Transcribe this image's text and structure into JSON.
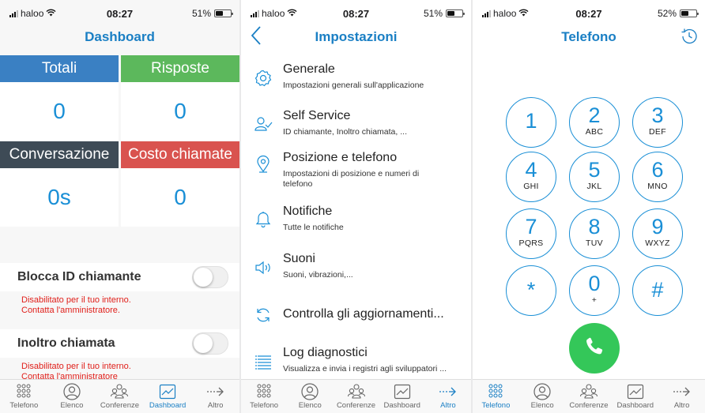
{
  "status": [
    {
      "carrier": "haloo",
      "time": "08:27",
      "battery": "51%",
      "battery_level": 0.51
    },
    {
      "carrier": "haloo",
      "time": "08:27",
      "battery": "51%",
      "battery_level": 0.51
    },
    {
      "carrier": "haloo",
      "time": "08:27",
      "battery": "52%",
      "battery_level": 0.52
    }
  ],
  "dashboard": {
    "title": "Dashboard",
    "tiles": [
      {
        "label": "Totali",
        "value": "0",
        "color": "#3a80c3"
      },
      {
        "label": "Risposte",
        "value": "0",
        "color": "#5cb85c"
      },
      {
        "label": "Conversazione",
        "value": "0s",
        "color": "#3e4b56"
      },
      {
        "label": "Costo chiamate",
        "value": "0",
        "color": "#d9534f"
      }
    ],
    "settings": [
      {
        "label": "Blocca ID chiamante",
        "enabled": false,
        "note_line1": "Disabilitato per il tuo interno.",
        "note_line2": "Contatta l'amministratore."
      },
      {
        "label": "Inoltro chiamata",
        "enabled": false,
        "note_line1": "Disabilitato per il tuo interno.",
        "note_line2": "Contatta l'amministratore"
      }
    ]
  },
  "impostazioni": {
    "title": "Impostazioni",
    "items": [
      {
        "title": "Generale",
        "subtitle": "Impostazioni generali sull'applicazione",
        "icon": "gear-icon"
      },
      {
        "title": "Self Service",
        "subtitle": "ID chiamante, Inoltro chiamata, ...",
        "icon": "user-check-icon"
      },
      {
        "title": "Posizione e telefono",
        "subtitle": "Impostazioni di posizione e numeri di telefono",
        "icon": "location-pin-icon"
      },
      {
        "title": "Notifiche",
        "subtitle": "Tutte le notifiche",
        "icon": "bell-icon"
      },
      {
        "title": "Suoni",
        "subtitle": "Suoni, vibrazioni,...",
        "icon": "speaker-icon"
      },
      {
        "title": "Controlla gli aggiornamenti...",
        "subtitle": "",
        "icon": "refresh-icon"
      },
      {
        "title": "Log diagnostici",
        "subtitle": "Visualizza e invia i registri agli sviluppatori ...",
        "icon": "list-icon"
      }
    ]
  },
  "telefono": {
    "title": "Telefono",
    "keys": [
      {
        "digit": "1",
        "letters": ""
      },
      {
        "digit": "2",
        "letters": "ABC"
      },
      {
        "digit": "3",
        "letters": "DEF"
      },
      {
        "digit": "4",
        "letters": "GHI"
      },
      {
        "digit": "5",
        "letters": "JKL"
      },
      {
        "digit": "6",
        "letters": "MNO"
      },
      {
        "digit": "7",
        "letters": "PQRS"
      },
      {
        "digit": "8",
        "letters": "TUV"
      },
      {
        "digit": "9",
        "letters": "WXYZ"
      },
      {
        "digit": "*",
        "letters": ""
      },
      {
        "digit": "0",
        "letters": "+"
      },
      {
        "digit": "#",
        "letters": ""
      }
    ]
  },
  "tabs": [
    {
      "label": "Telefono",
      "icon": "keypad-icon"
    },
    {
      "label": "Elenco",
      "icon": "contact-icon"
    },
    {
      "label": "Conferenze",
      "icon": "group-icon"
    },
    {
      "label": "Dashboard",
      "icon": "chart-icon"
    },
    {
      "label": "Altro",
      "icon": "more-arrow-icon"
    }
  ],
  "colors": {
    "accent": "#1a7fc4",
    "call": "#34c759",
    "warning": "#e0201b"
  }
}
